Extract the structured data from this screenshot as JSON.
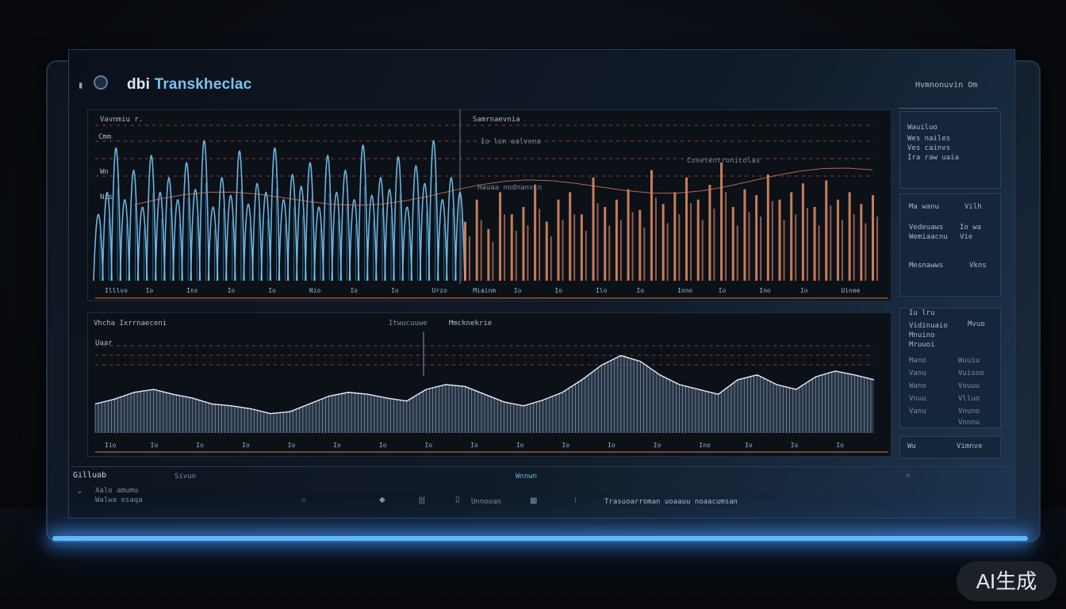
{
  "app": {
    "title_prefix": "dbi ",
    "title": "Transkheclac"
  },
  "top_chart": {
    "label_top_left": "Vavnmiu r.",
    "label_top_right": "Samrnaevnia",
    "y_labels": [
      "Cmm",
      "Wn",
      "Nis"
    ],
    "x_labels": [
      "Illlvo",
      "Io",
      "Ins",
      "Io",
      "Io",
      "Nio",
      "Io",
      "Io",
      "Urzo",
      "Miainm",
      "Io",
      "Io",
      "Ilo",
      "Io",
      "Inno",
      "Io",
      "Ino",
      "Io",
      "Uinee"
    ],
    "sub_labels": [
      "Io lon aalvena",
      "Covetentronicolas",
      "Hauaa nodnanvin"
    ]
  },
  "bottom_chart": {
    "label_left": "Vhcha Ixrrnaeceni",
    "label_mid": "Itwucuuwe",
    "label_right": "Mmcknekrie",
    "y_label": "Uaar",
    "x_labels": [
      "Iio",
      "Io",
      "Io",
      "Io",
      "Io",
      "Io",
      "Io",
      "Io",
      "Io",
      "Io",
      "Io",
      "Io",
      "Io",
      "Ino",
      "Io",
      "Io",
      "Io"
    ]
  },
  "sidebar": {
    "header": "Hvmnonuvin Om",
    "block1": [
      "Wauiluo",
      "Wes nailes",
      "Ves cainvs",
      "Ira raw uaia"
    ],
    "block2_left": [
      "Ma wanu",
      "Vedeuaws",
      "Wemiaacnu",
      "Mesnawws"
    ],
    "block2_right": [
      "Vilh",
      "Io wa",
      "Vie",
      "Vkns"
    ],
    "block3_left": [
      "Iu lru",
      "Vidinuaio",
      "Mnuino",
      "Mruuoi",
      "Mano",
      "Vanu",
      "Wano",
      "Vnuu",
      "Vanu"
    ],
    "block3_right": [
      "Mvuo",
      "Wuuiu",
      "Vuisoo",
      "Vouuu",
      "Vlluo",
      "Vnuno",
      "Vnnnu"
    ],
    "footer_left": "Wu",
    "footer_right": "Vimnve"
  },
  "bottom_bar": {
    "section_title": "Gilluab",
    "section_label": "Sivun",
    "section_center": "Wnnwn",
    "info_lines": [
      "Xalo amumu",
      "Walwa esaqa"
    ],
    "status_text": "Trasuoarroman uoaauu noaacumsan",
    "toolbar_text": "Unnooan"
  },
  "badge": "AI生成",
  "colors": {
    "blue_series": "#74c7f5",
    "orange_series": "#e99065",
    "red_grid": "#c8473b",
    "wave": "#cfd8e6"
  },
  "chart_data": [
    {
      "type": "line",
      "title": "",
      "series": [
        {
          "values": [
            0.45,
            0.6,
            0.9,
            0.55,
            0.75,
            0.5,
            0.85,
            0.6,
            0.7,
            0.55,
            0.8,
            0.62,
            0.95,
            0.5,
            0.7,
            0.58,
            0.88,
            0.52,
            0.66,
            0.6,
            0.9,
            0.55,
            0.72,
            0.64,
            0.8,
            0.5,
            0.85,
            0.6,
            0.75,
            0.55,
            0.92,
            0.58,
            0.7,
            0.62,
            0.84,
            0.5,
            0.78,
            0.66,
            0.95,
            0.55,
            0.7,
            0.6
          ]
        },
        {
          "values": [
            0.4,
            0.55,
            0.35,
            0.6,
            0.45,
            0.5,
            0.65,
            0.4,
            0.55,
            0.6,
            0.45,
            0.7,
            0.5,
            0.55,
            0.62,
            0.48,
            0.75,
            0.52,
            0.6,
            0.7,
            0.55,
            0.65,
            0.8,
            0.5,
            0.62,
            0.58,
            0.72,
            0.55,
            0.6,
            0.66,
            0.5,
            0.68,
            0.55,
            0.6,
            0.52,
            0.58
          ]
        }
      ],
      "ylim": [
        0,
        1
      ]
    },
    {
      "type": "area",
      "title": "",
      "values": [
        0.3,
        0.35,
        0.42,
        0.45,
        0.4,
        0.36,
        0.3,
        0.28,
        0.25,
        0.2,
        0.22,
        0.3,
        0.38,
        0.42,
        0.4,
        0.36,
        0.33,
        0.45,
        0.5,
        0.48,
        0.4,
        0.32,
        0.28,
        0.34,
        0.42,
        0.55,
        0.7,
        0.8,
        0.74,
        0.6,
        0.5,
        0.45,
        0.4,
        0.55,
        0.6,
        0.5,
        0.45,
        0.58,
        0.64,
        0.6,
        0.55
      ],
      "ylim": [
        0,
        1
      ]
    }
  ]
}
